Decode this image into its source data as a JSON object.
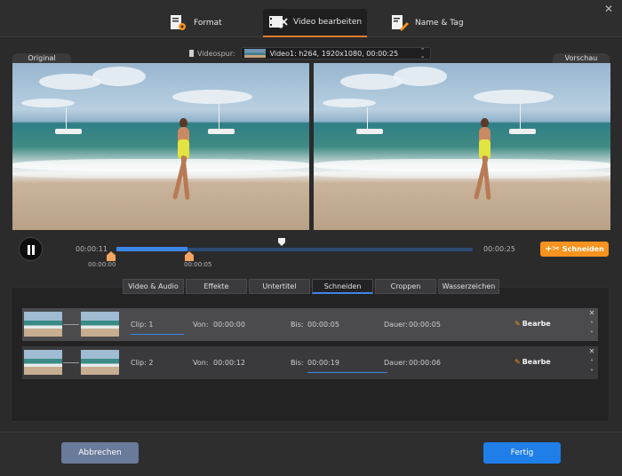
{
  "tabs": [
    {
      "label": "Format",
      "icon": "format-settings-icon",
      "active": false
    },
    {
      "label": "Video bearbeiten",
      "icon": "video-edit-icon",
      "active": true
    },
    {
      "label": "Name & Tag",
      "icon": "name-tag-icon",
      "active": false
    }
  ],
  "preview": {
    "original_label": "Original",
    "vorschau_label": "Vorschau",
    "videospur_label": "Videospur:",
    "track_value": "Video1: h264, 1920x1080, 00:00:25"
  },
  "timeline": {
    "current_time": "00:00:11",
    "end_time": "00:00:25",
    "start_marker": "00:00:00",
    "end_marker": "00:00:05",
    "cut_button": "Schneiden"
  },
  "subtabs": [
    {
      "label": "Video & Audio",
      "active": false
    },
    {
      "label": "Effekte",
      "active": false
    },
    {
      "label": "Untertitel",
      "active": false
    },
    {
      "label": "Schneiden",
      "active": true
    },
    {
      "label": "Croppen",
      "active": false
    },
    {
      "label": "Wasserzeichen",
      "active": false
    }
  ],
  "clips": [
    {
      "clip": "Clip: 1",
      "von_label": "Von:",
      "von": "00:00:00",
      "bis_label": "Bis:",
      "bis": "00:00:05",
      "dauer_label": "Dauer:",
      "dauer": "00:00:05",
      "edit": "Bearbe"
    },
    {
      "clip": "Clip: 2",
      "von_label": "Von:",
      "von": "00:00:12",
      "bis_label": "Bis:",
      "bis": "00:00:19",
      "dauer_label": "Dauer:",
      "dauer": "00:00:06",
      "edit": "Bearbe"
    }
  ],
  "footer": {
    "cancel": "Abbrechen",
    "done": "Fertig"
  },
  "colors": {
    "accent_orange": "#f7931e",
    "accent_blue": "#1f7ee8",
    "cancel_button": "#6a7a9a"
  }
}
